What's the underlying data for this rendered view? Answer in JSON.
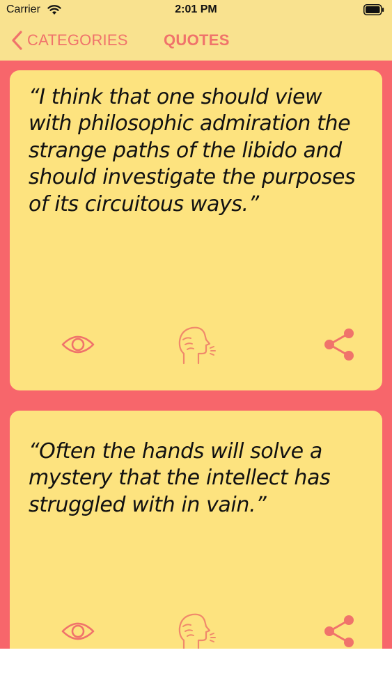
{
  "status_bar": {
    "carrier": "Carrier",
    "time": "2:01 PM"
  },
  "nav": {
    "back_label": "CATEGORIES",
    "title": "QUOTES"
  },
  "quotes": [
    {
      "text": "“I think that one should view with philosophic admiration the strange paths of the libido and should investigate the purposes of its circuitous ways.”"
    },
    {
      "text": "“Often the hands will solve a mystery that the intellect has struggled with in vain.”"
    }
  ],
  "icons": {
    "view": "eye-icon",
    "speak": "speaking-head-icon",
    "share": "share-icon"
  },
  "colors": {
    "bar_background": "#f9e28f",
    "content_background": "#f7666b",
    "card_background": "#fde37f",
    "accent": "#f0736b"
  }
}
